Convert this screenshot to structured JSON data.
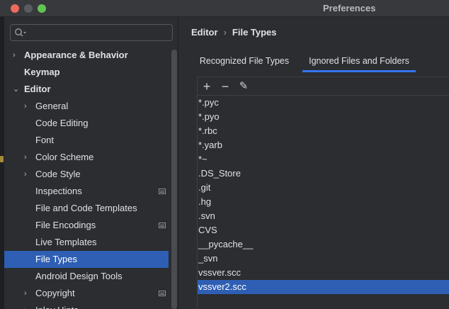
{
  "window": {
    "title": "Preferences"
  },
  "sidebar": {
    "search": {
      "placeholder": ""
    },
    "items": [
      {
        "label": "Appearance & Behavior",
        "arrow": "›",
        "bold": true,
        "level": 0,
        "selected": false,
        "badge": false
      },
      {
        "label": "Keymap",
        "arrow": "",
        "bold": true,
        "level": 0,
        "selected": false,
        "badge": false
      },
      {
        "label": "Editor",
        "arrow": "⌄",
        "bold": true,
        "level": 0,
        "selected": false,
        "badge": false
      },
      {
        "label": "General",
        "arrow": "›",
        "bold": false,
        "level": 1,
        "selected": false,
        "badge": false
      },
      {
        "label": "Code Editing",
        "arrow": "",
        "bold": false,
        "level": 1,
        "selected": false,
        "badge": false
      },
      {
        "label": "Font",
        "arrow": "",
        "bold": false,
        "level": 1,
        "selected": false,
        "badge": false
      },
      {
        "label": "Color Scheme",
        "arrow": "›",
        "bold": false,
        "level": 1,
        "selected": false,
        "badge": false
      },
      {
        "label": "Code Style",
        "arrow": "›",
        "bold": false,
        "level": 1,
        "selected": false,
        "badge": false
      },
      {
        "label": "Inspections",
        "arrow": "",
        "bold": false,
        "level": 1,
        "selected": false,
        "badge": true
      },
      {
        "label": "File and Code Templates",
        "arrow": "",
        "bold": false,
        "level": 1,
        "selected": false,
        "badge": false
      },
      {
        "label": "File Encodings",
        "arrow": "",
        "bold": false,
        "level": 1,
        "selected": false,
        "badge": true
      },
      {
        "label": "Live Templates",
        "arrow": "",
        "bold": false,
        "level": 1,
        "selected": false,
        "badge": false
      },
      {
        "label": "File Types",
        "arrow": "",
        "bold": false,
        "level": 1,
        "selected": true,
        "badge": false
      },
      {
        "label": "Android Design Tools",
        "arrow": "",
        "bold": false,
        "level": 1,
        "selected": false,
        "badge": false
      },
      {
        "label": "Copyright",
        "arrow": "›",
        "bold": false,
        "level": 1,
        "selected": false,
        "badge": true
      },
      {
        "label": "Inlay Hints",
        "arrow": "›",
        "bold": false,
        "level": 1,
        "selected": false,
        "badge": false
      }
    ]
  },
  "main": {
    "breadcrumb": {
      "parent": "Editor",
      "separator": "›",
      "current": "File Types"
    },
    "tabs": [
      {
        "label": "Recognized File Types",
        "active": false
      },
      {
        "label": "Ignored Files and Folders",
        "active": true
      }
    ],
    "toolbar": {
      "add": "+",
      "remove": "−",
      "edit": "✎"
    },
    "ignored_patterns": [
      "*.pyc",
      "*.pyo",
      "*.rbc",
      "*.yarb",
      "*~",
      ".DS_Store",
      ".git",
      ".hg",
      ".svn",
      "CVS",
      "__pycache__",
      "_svn",
      "vssver.scc",
      "vssver2.scc"
    ],
    "selected_pattern": "vssver2.scc"
  },
  "colors": {
    "accent": "#3574f0",
    "selection": "#2e5fb4",
    "background": "#2b2d30"
  }
}
